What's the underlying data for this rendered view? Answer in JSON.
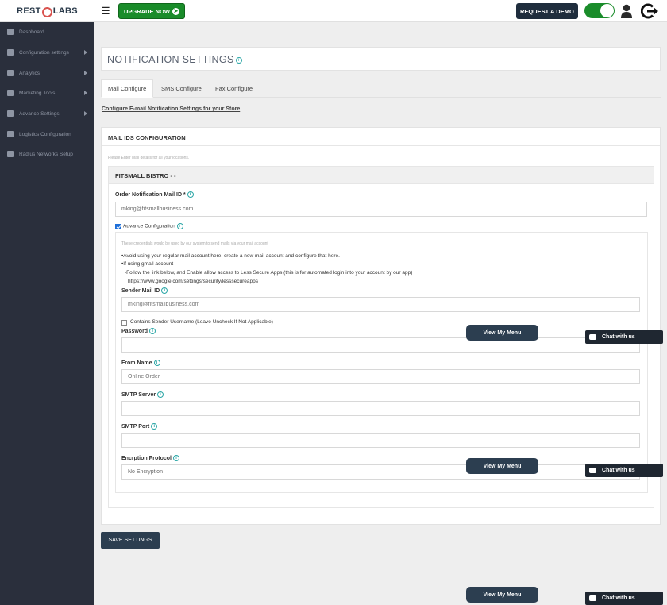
{
  "header": {
    "logo_left": "REST",
    "logo_right": "LABS",
    "upgrade_label": "UPGRADE NOW",
    "demo_label": "REQUEST A DEMO",
    "toggle_on": true
  },
  "sidebar": {
    "items": [
      {
        "label": "Dashboard",
        "icon": "dashboard-icon",
        "has_caret": false
      },
      {
        "label": "Configuration settings",
        "icon": "bank-icon",
        "has_caret": true
      },
      {
        "label": "Analytics",
        "icon": "analytics-icon",
        "has_caret": true
      },
      {
        "label": "Marketing Tools",
        "icon": "megaphone-icon",
        "has_caret": true
      },
      {
        "label": "Advance Settings",
        "icon": "wrench-icon",
        "has_caret": true
      },
      {
        "label": "Logistics Configuration",
        "icon": "gear-icon",
        "has_caret": false
      },
      {
        "label": "Radius Networks Setup",
        "icon": "gear-icon",
        "has_caret": false
      }
    ]
  },
  "page": {
    "title": "NOTIFICATION SETTINGS",
    "tabs": [
      "Mail Configure",
      "SMS Configure",
      "Fax Configure"
    ],
    "active_tab": "Mail Configure",
    "config_link": "Configure E-mail Notification Settings for your Store"
  },
  "mail_panel": {
    "title": "MAIL IDS CONFIGURATION",
    "subtitle": "Please Enter Mail details for all your locations.",
    "location": "FITSMALL BISTRO - -",
    "order_label": "Order Notification Mail ID *",
    "order_value": "mking@fitsmallbusiness.com",
    "advance_label": "Advance Configuration",
    "advance_checked": true,
    "credentials_note": "These credentials would be used by our system to send mails via your mail account",
    "tip1": "•Avoid using your regular mail account here, create a new mail account and configure that here.",
    "tip2": "•If using gmail account -",
    "tip3": "-Follow the link below, and Enable allow access to Less Secure Apps (this is for automated login into your account by our app)",
    "tip_link": "https://www.google.com/settings/security/lesssecureapps",
    "sender_label": "Sender Mail ID",
    "sender_placeholder": "mking@fitsmallbusiness.com",
    "contains_username_label": "Contains Sender Username (Leave Uncheck If Not Applicable)",
    "contains_username_checked": false,
    "password_label": "Password",
    "from_name_label": "From Name",
    "from_name_placeholder": "Online Order",
    "smtp_server_label": "SMTP Server",
    "smtp_port_label": "SMTP Port",
    "encryption_label": "Encrption Protocol",
    "encryption_value": "No Encryption"
  },
  "save_label": "SAVE SETTINGS",
  "widgets": {
    "menu_label": "View My Menu",
    "chat_label": "Chat with us"
  },
  "colors": {
    "sidebar_bg": "#2a2f3c",
    "upgrade_green": "#1a8c2a",
    "navy_button": "#2c3e50",
    "info_teal": "#2aa6a6"
  }
}
